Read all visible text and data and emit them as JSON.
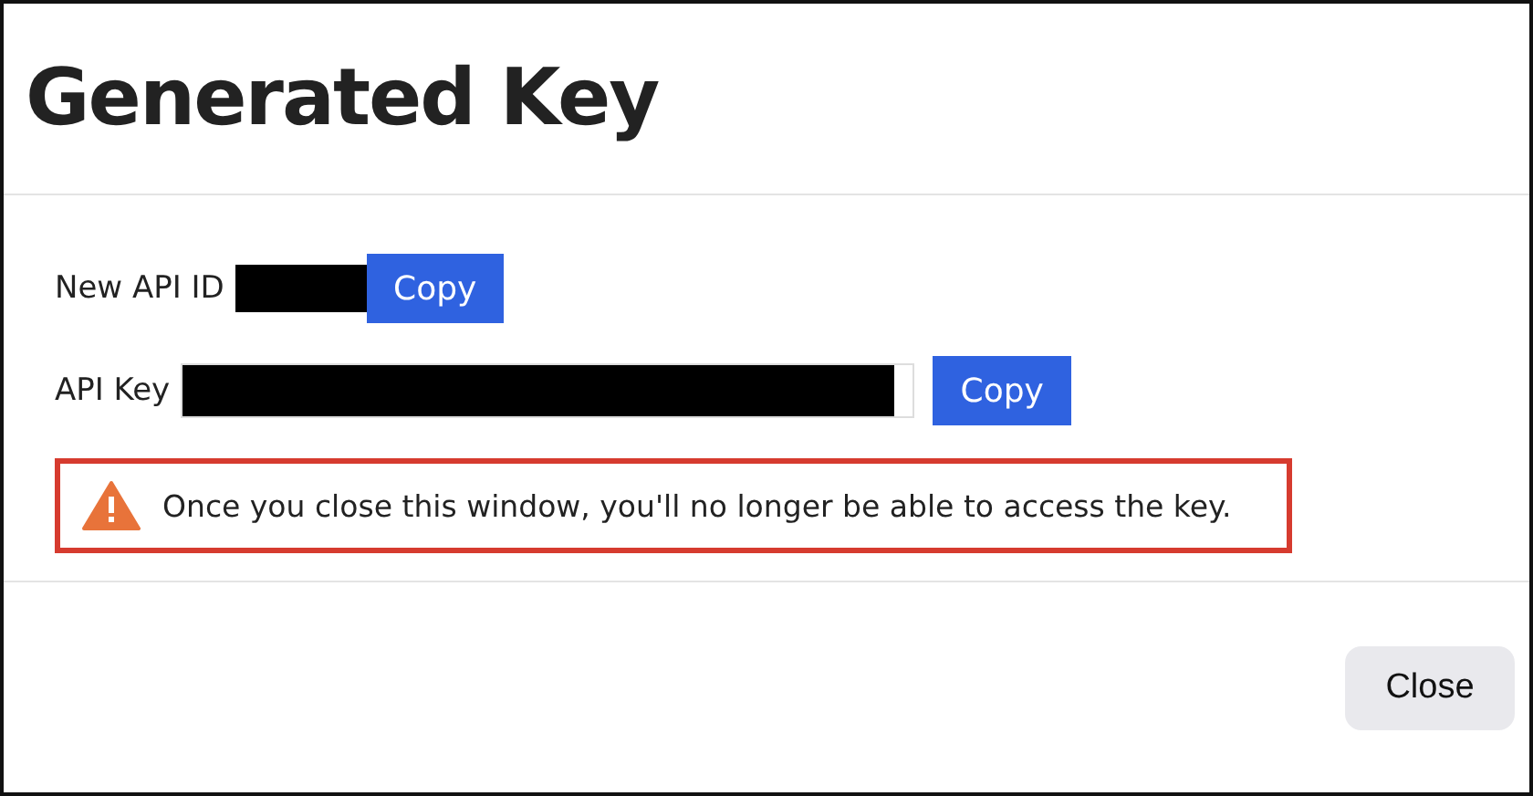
{
  "dialog": {
    "title": "Generated Key"
  },
  "fields": [
    {
      "label": "New API ID",
      "kind": "plain",
      "button": "Copy"
    },
    {
      "label": "API Key",
      "kind": "input",
      "button": "Copy"
    }
  ],
  "warning": {
    "text": "Once you close this window, you'll no longer be able to access the key."
  },
  "footer": {
    "buttons": [
      "Close"
    ]
  }
}
